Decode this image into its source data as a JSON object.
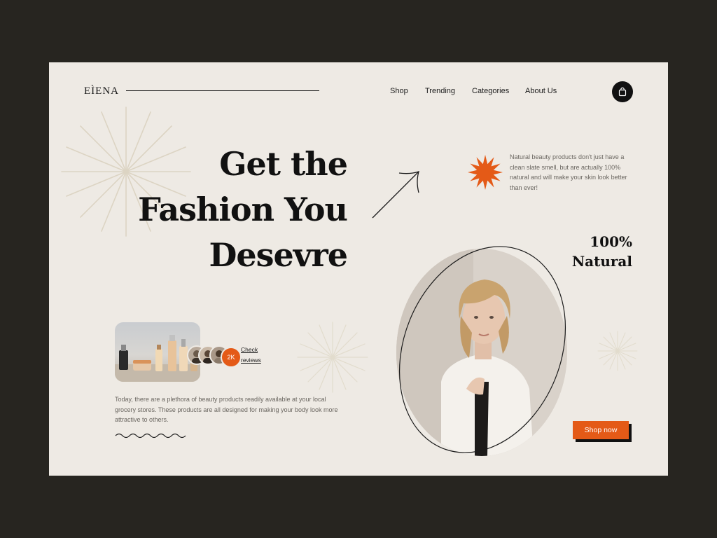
{
  "brand": {
    "logo": "EÌENA"
  },
  "nav": {
    "items": [
      {
        "label": "Shop"
      },
      {
        "label": "Trending"
      },
      {
        "label": "Categories"
      },
      {
        "label": "About Us"
      }
    ],
    "cart_icon": "shopping-bag-icon"
  },
  "hero": {
    "headline_line1": "Get the",
    "headline_line2": "Fashion You",
    "headline_line3": "Desevre",
    "side_description": "Natural beauty products don't just have a clean slate smell, but are actually 100% natural and will make your skin look better than ever!",
    "badge_line1": "100%",
    "badge_line2": "Natural",
    "cta_label": "Shop now"
  },
  "reviews": {
    "count": "2K",
    "link_label": "Check reviews"
  },
  "body_text": "Today, there are a plethora of beauty products readily available at your local grocery stores. These products are all designed for making your body look more attractive to others.",
  "colors": {
    "accent": "#e45a17",
    "background": "#eeeae4",
    "frame": "#272520",
    "text": "#111111"
  }
}
